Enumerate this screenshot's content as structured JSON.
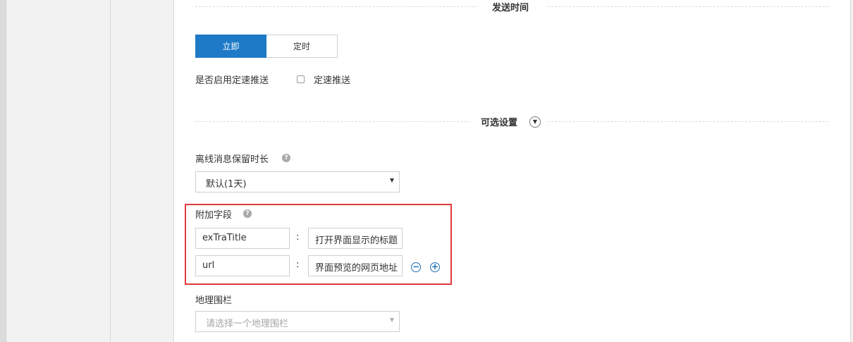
{
  "sections": {
    "send_time": "发送时间",
    "optional_settings": "可选设置"
  },
  "send_mode": {
    "options": [
      "立即",
      "定时"
    ],
    "selected": "立即"
  },
  "speed_push": {
    "label": "是否启用定速推送",
    "checkbox_label": "定速推送",
    "checked": false
  },
  "offline_retention": {
    "label": "离线消息保留时长",
    "value": "默认(1天)"
  },
  "extra_fields": {
    "label": "附加字段",
    "rows": [
      {
        "key": "exTraTitle",
        "value": "打开界面显示的标题"
      },
      {
        "key": "url",
        "value": "界面预览的网页地址"
      }
    ]
  },
  "geofence": {
    "label": "地理围栏",
    "placeholder": "请选择一个地理围栏"
  },
  "icons": {
    "help": "?",
    "expand": "▼",
    "remove": "−",
    "add": "+"
  },
  "colors": {
    "primary": "#1e7ac7",
    "highlight": "#e03a3a"
  }
}
